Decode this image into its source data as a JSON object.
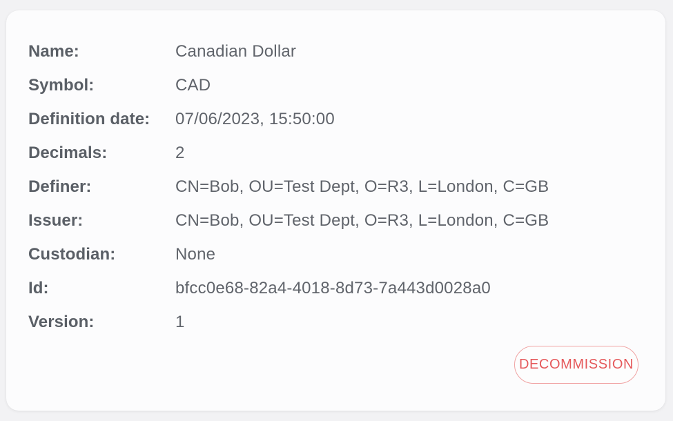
{
  "token": {
    "fields": [
      {
        "label": "Name:",
        "value": "Canadian Dollar"
      },
      {
        "label": "Symbol:",
        "value": "CAD"
      },
      {
        "label": "Definition date:",
        "value": "07/06/2023, 15:50:00"
      },
      {
        "label": "Decimals:",
        "value": "2"
      },
      {
        "label": "Definer:",
        "value": "CN=Bob, OU=Test Dept, O=R3, L=London, C=GB"
      },
      {
        "label": "Issuer:",
        "value": "CN=Bob, OU=Test Dept, O=R3, L=London, C=GB"
      },
      {
        "label": "Custodian:",
        "value": "None"
      },
      {
        "label": "Id:",
        "value": "bfcc0e68-82a4-4018-8d73-7a443d0028a0"
      },
      {
        "label": "Version:",
        "value": "1"
      }
    ]
  },
  "actions": {
    "decommission_label": "DECOMMISSION"
  },
  "colors": {
    "danger": "#e5595b",
    "danger_border": "#f0a3a3",
    "label_text": "#5a5f66",
    "value_text": "#60646b"
  }
}
